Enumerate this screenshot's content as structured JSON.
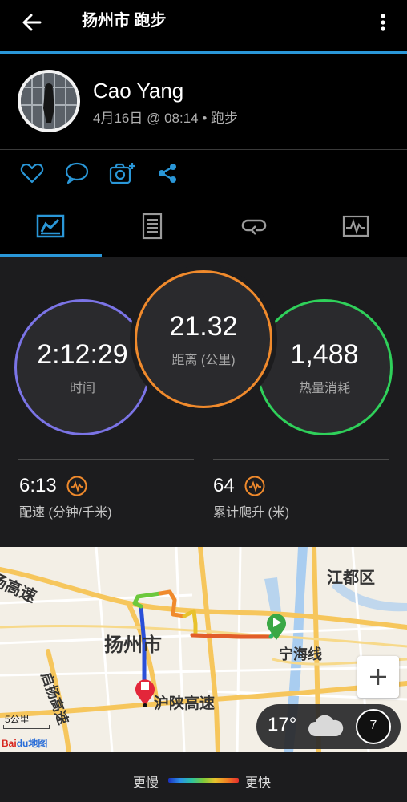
{
  "header": {
    "title": "扬州市 跑步"
  },
  "profile": {
    "name": "Cao Yang",
    "meta": "4月16日 @ 08:14 • 跑步"
  },
  "actions": [
    "heart-icon",
    "comment-icon",
    "add-photo-icon",
    "share-icon"
  ],
  "tabs": [
    {
      "name": "overview",
      "icon": "stats-card-icon",
      "active": true
    },
    {
      "name": "details",
      "icon": "document-list-icon",
      "active": false
    },
    {
      "name": "laps",
      "icon": "laps-loop-icon",
      "active": false
    },
    {
      "name": "charts",
      "icon": "graph-chart-icon",
      "active": false
    }
  ],
  "stats": {
    "time": {
      "value": "2:12:29",
      "label": "时间"
    },
    "distance": {
      "value": "21.32",
      "label": "距离 (公里)"
    },
    "calories": {
      "value": "1,488",
      "label": "热量消耗"
    },
    "pace": {
      "value": "6:13",
      "label": "配速 (分钟/千米)"
    },
    "elevation": {
      "value": "64",
      "label": "累计爬升 (米)"
    }
  },
  "map": {
    "labels": {
      "expressway_left": "扬高速",
      "district": "江都区",
      "city": "扬州市",
      "line": "宁海线",
      "qiyang": "启扬高速",
      "hushan": "沪陕高速"
    },
    "scale": "5公里",
    "provider": {
      "bai": "Bai",
      "du": "du",
      "tu": "地图"
    },
    "weather": {
      "temp": "17°",
      "icon": "cloud-icon",
      "zoom_level": "7"
    },
    "zoom_in": "+"
  },
  "legend": {
    "slow": "更慢",
    "fast": "更快"
  },
  "colors": {
    "accent": "#2a97d8",
    "time_ring": "#7b74e6",
    "distance_ring": "#f08a2c",
    "calories_ring": "#2fd05a",
    "action_icons": "#2a97d8"
  }
}
